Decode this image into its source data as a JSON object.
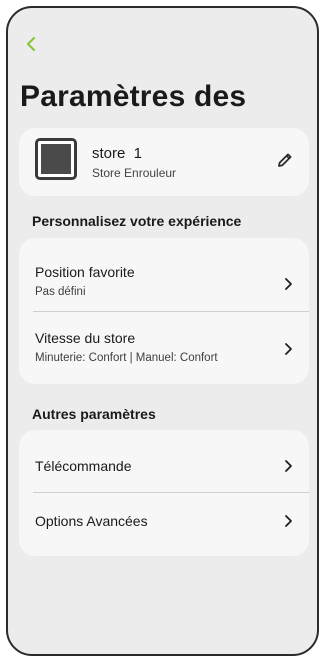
{
  "header": {
    "title": "Paramètres des",
    "back_icon": "chevron-left-icon",
    "back_color": "#8bc53f"
  },
  "device": {
    "name": "store  1",
    "type": "Store Enrouleur",
    "thumbnail_icon": "roller-blind-icon",
    "edit_icon": "pencil-icon"
  },
  "sections": {
    "personalize_title": "Personnalisez votre expérience",
    "other_title": "Autres paramètres"
  },
  "personalize_items": [
    {
      "label": "Position favorite",
      "sub": "Pas défini"
    },
    {
      "label": "Vitesse du store",
      "sub": "Minuterie: Confort | Manuel: Confort"
    }
  ],
  "other_items": [
    {
      "label": "Télécommande"
    },
    {
      "label": "Options Avancées"
    }
  ],
  "colors": {
    "accent": "#8bc53f",
    "background": "#ececec",
    "card": "#f7f7f7"
  }
}
